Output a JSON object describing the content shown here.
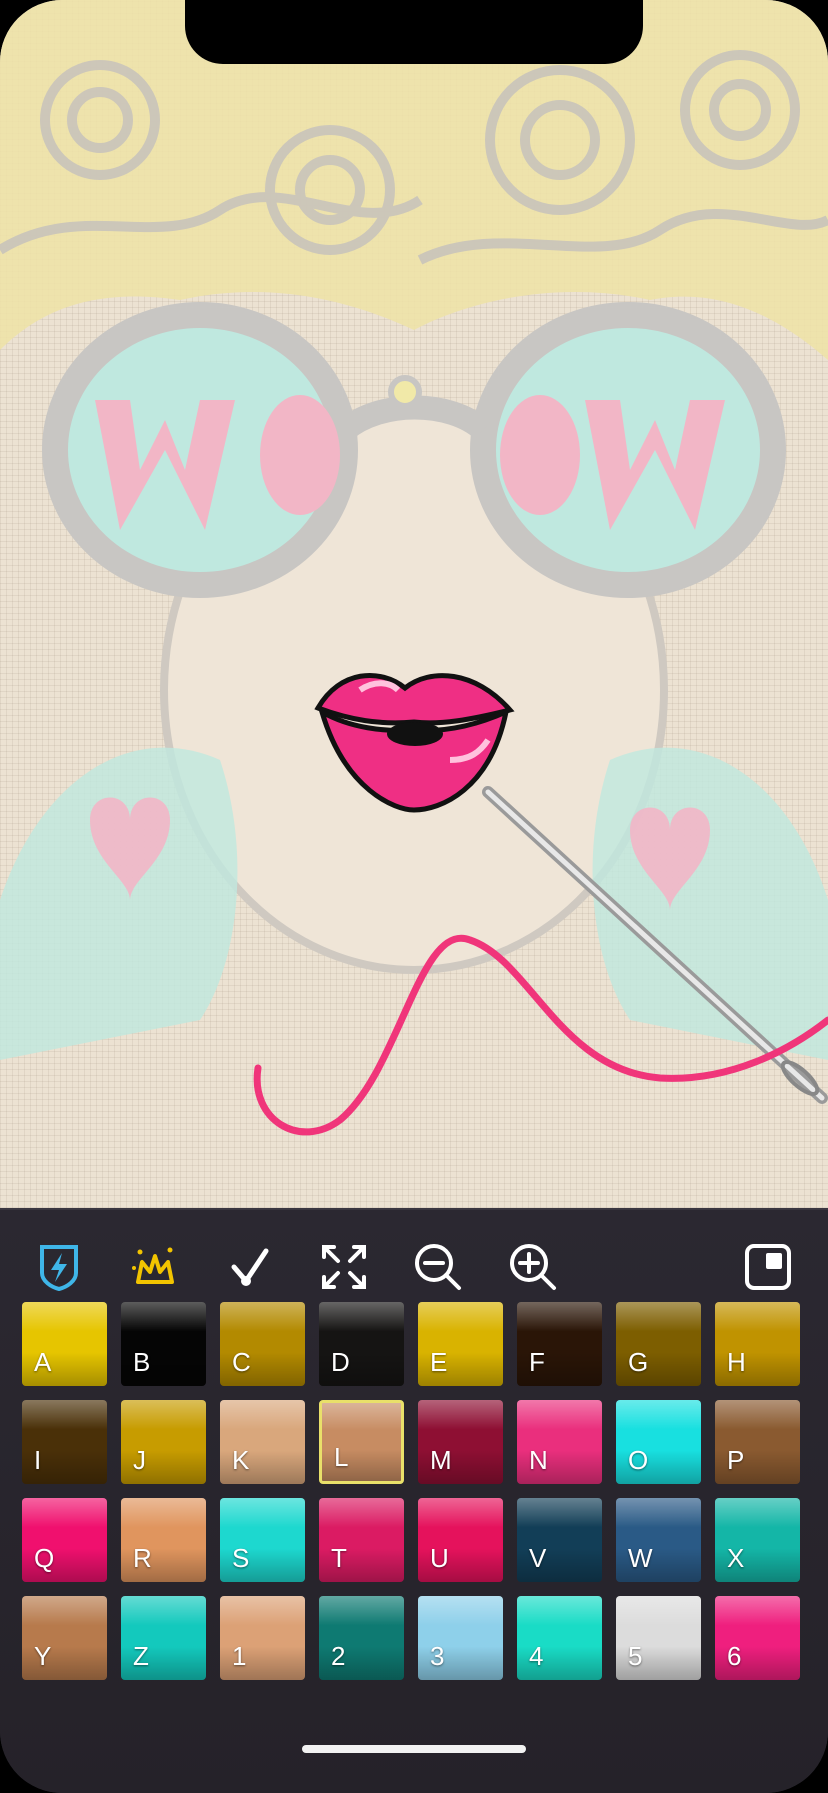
{
  "app": {
    "accent_color": "#3fb6e8",
    "selection_color": "#e9e06a",
    "thread_color": "#f0357a",
    "canvas_color": "#ece2d2"
  },
  "toolbar": {
    "tools": [
      {
        "name": "lightning-shield-icon",
        "color": "#3fb6e8"
      },
      {
        "name": "magic-wand-icon",
        "color": "#f2c400"
      },
      {
        "name": "checkmark-needle-icon",
        "color": "#ffffff"
      },
      {
        "name": "fit-screen-icon",
        "color": "#ffffff"
      },
      {
        "name": "zoom-out-icon",
        "color": "#ffffff"
      },
      {
        "name": "zoom-in-icon",
        "color": "#ffffff"
      },
      {
        "name": "minimap-icon",
        "color": "#ffffff"
      }
    ]
  },
  "palette": {
    "selected": "L",
    "swatches": [
      {
        "label": "A",
        "color": "#e6c500"
      },
      {
        "label": "B",
        "color": "#050505"
      },
      {
        "label": "C",
        "color": "#b38a00"
      },
      {
        "label": "D",
        "color": "#151413"
      },
      {
        "label": "E",
        "color": "#d9b300"
      },
      {
        "label": "F",
        "color": "#2a1507"
      },
      {
        "label": "G",
        "color": "#7d5e00"
      },
      {
        "label": "H",
        "color": "#c09300"
      },
      {
        "label": "I",
        "color": "#4a3008"
      },
      {
        "label": "J",
        "color": "#c79c00"
      },
      {
        "label": "K",
        "color": "#d9a77c"
      },
      {
        "label": "L",
        "color": "#c78c62"
      },
      {
        "label": "M",
        "color": "#8e0f33"
      },
      {
        "label": "N",
        "color": "#ea2f7d"
      },
      {
        "label": "O",
        "color": "#18e0e0"
      },
      {
        "label": "P",
        "color": "#8a5a30"
      },
      {
        "label": "Q",
        "color": "#f0106e"
      },
      {
        "label": "R",
        "color": "#e0955e"
      },
      {
        "label": "S",
        "color": "#1dd8cf"
      },
      {
        "label": "T",
        "color": "#db1b63"
      },
      {
        "label": "U",
        "color": "#e5125c"
      },
      {
        "label": "V",
        "color": "#123e57"
      },
      {
        "label": "W",
        "color": "#2a5a86"
      },
      {
        "label": "X",
        "color": "#14b6a7"
      },
      {
        "label": "Y",
        "color": "#b77a4c"
      },
      {
        "label": "Z",
        "color": "#13c9bd"
      },
      {
        "label": "1",
        "color": "#dca176"
      },
      {
        "label": "2",
        "color": "#0e7a72"
      },
      {
        "label": "3",
        "color": "#8ed0ea"
      },
      {
        "label": "4",
        "color": "#19dcc6"
      },
      {
        "label": "5",
        "color": "#dcdcdc"
      },
      {
        "label": "6",
        "color": "#ef1f7e"
      }
    ]
  }
}
